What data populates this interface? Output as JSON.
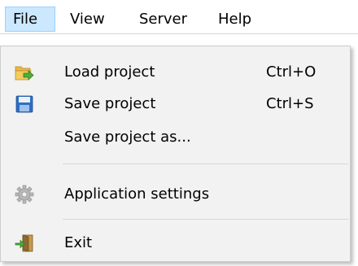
{
  "menubar": {
    "items": [
      {
        "label": "File",
        "active": true
      },
      {
        "label": "View"
      },
      {
        "label": "Server"
      },
      {
        "label": "Help"
      }
    ]
  },
  "file_menu": {
    "items": [
      {
        "label": "Load project",
        "shortcut": "Ctrl+O",
        "icon": "folder-open-arrow-icon"
      },
      {
        "label": "Save project",
        "shortcut": "Ctrl+S",
        "icon": "floppy-disk-icon"
      },
      {
        "label": "Save project as..."
      },
      {
        "label": "Application settings",
        "icon": "gear-icon"
      },
      {
        "label": "Exit",
        "icon": "exit-door-icon"
      }
    ]
  },
  "colors": {
    "menubar_active_bg": "#cce8ff",
    "menubar_active_border": "#99d1ff",
    "dropdown_bg": "#f2f2f2",
    "separator": "#d7d7d7"
  }
}
